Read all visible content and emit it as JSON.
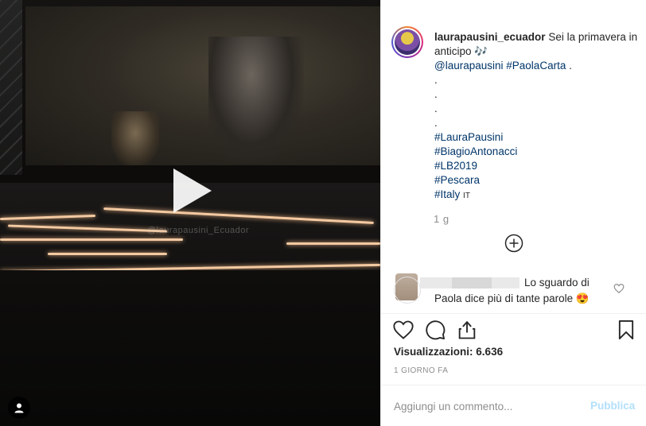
{
  "post": {
    "username": "laurapausini_ecuador",
    "caption_text": "Sei la primavera in anticipo",
    "caption_emoji": "🎶",
    "mention": "@laurapausini",
    "hashtag_main": "#PaolaCarta",
    "trailing_dot": ".",
    "dots": [
      ".",
      ".",
      ".",
      "."
    ],
    "hashtags": [
      "#LauraPausini",
      "#BiagioAntonacci",
      "#LB2019",
      "#Pescara",
      "#Italy"
    ],
    "italy_flag": "IT",
    "time_ago": "1 g"
  },
  "video": {
    "watermark": "@laurapausini_Ecuador"
  },
  "comment": {
    "text_line1": "Lo sguardo di",
    "text_line2": "Paola dice più di tante parole 😍"
  },
  "stats": {
    "views_label": "Visualizzazioni:",
    "views_count": "6.636",
    "posted": "1 GIORNO FA"
  },
  "composer": {
    "placeholder": "Aggiungi un commento...",
    "publish_label": "Pubblica"
  },
  "icons": {
    "play": "play-icon",
    "user": "user-tag-icon",
    "add": "plus-circle-icon",
    "heart": "heart-icon",
    "comment": "comment-icon",
    "share": "share-icon",
    "save": "bookmark-icon"
  },
  "colors": {
    "link": "#003569",
    "muted": "#8e8e8e",
    "publish_disabled": "#b2dffc"
  }
}
